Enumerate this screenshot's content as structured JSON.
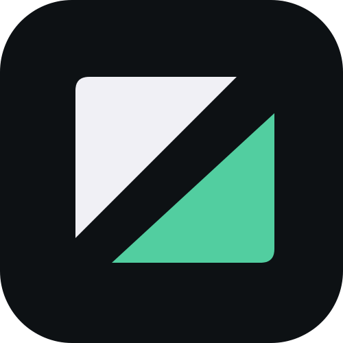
{
  "icon": {
    "background_color": "#0d1114",
    "light_shape_color": "#f0f0f5",
    "accent_shape_color": "#52cea0",
    "semantic": "app-logo-icon"
  }
}
